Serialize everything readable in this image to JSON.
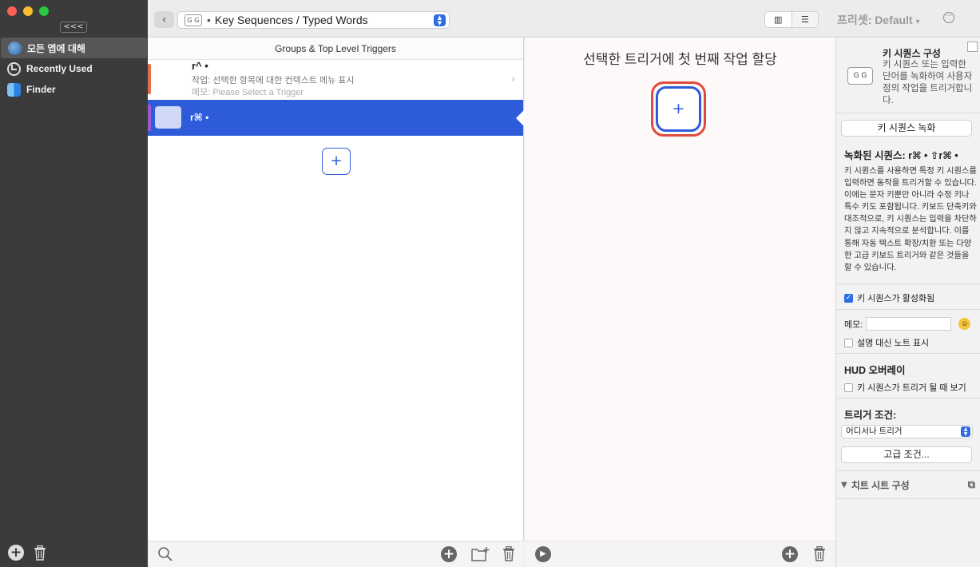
{
  "sidebar": {
    "collapse_label": "<<<",
    "items": [
      {
        "label": "모든 앱에 대해",
        "icon": "globe-icon"
      },
      {
        "label": "Recently Used",
        "icon": "clock-icon"
      },
      {
        "label": "Finder",
        "icon": "finder-icon"
      }
    ]
  },
  "toolbar": {
    "path_icon_text": "G G",
    "path_label": "Key Sequences / Typed Words",
    "preset_label": "프리셋: Default",
    "preset_chevron": "▾"
  },
  "triggers": {
    "header": "Groups & Top Level Triggers",
    "rows": [
      {
        "title": "r^ •",
        "action": "작업: 선택한 항목에 대한 컨텍스트 메뉴 표시",
        "memo": "메모: Please Select a Trigger"
      },
      {
        "title": "r⌘ •"
      }
    ],
    "add_label": "+"
  },
  "actions": {
    "header": "선택한 트리거에 첫 번째 작업 할당",
    "add_label": "+"
  },
  "inspector": {
    "icon_text": "G G",
    "title": "키 시퀀스 구성",
    "description": "키 시퀀스 또는 입력한 단어를 녹화하여 사용자 정의 작업을 트리거합니다.",
    "record_button": "키 시퀀스 녹화",
    "recorded_label": "녹화된 시퀀스: r⌘ • ⇧r⌘ •",
    "explanation": "키 시퀀스를 사용하면 특정 키 시퀀스를 입력하면 동작을 트리거할 수 있습니다. 이에는 문자 키뿐만 아니라 수정 키나 특수 키도 포함됩니다. 키보드 단축키와 대조적으로, 키 시퀀스는 입력을 차단하지 않고 지속적으로 분석합니다. 이를 통해 자동 텍스트 확장/치환 또는 다양한 고급 키보드 트리거와 같은 것들을 할 수 있습니다.",
    "enabled_label": "키 시퀀스가 활성화됨",
    "enabled_checked": true,
    "memo_label": "메모:",
    "memo_value": "",
    "show_note_label": "설명 대신 노트 표시",
    "hud_title": "HUD 오버레이",
    "hud_option": "키 시퀀스가 트리거 될 때 보기",
    "condition_title": "트리거 조건:",
    "condition_value": "어디서나 트리거",
    "advanced_button": "고급 조건...",
    "cheatsheet_label": "치트 시트 구성"
  }
}
